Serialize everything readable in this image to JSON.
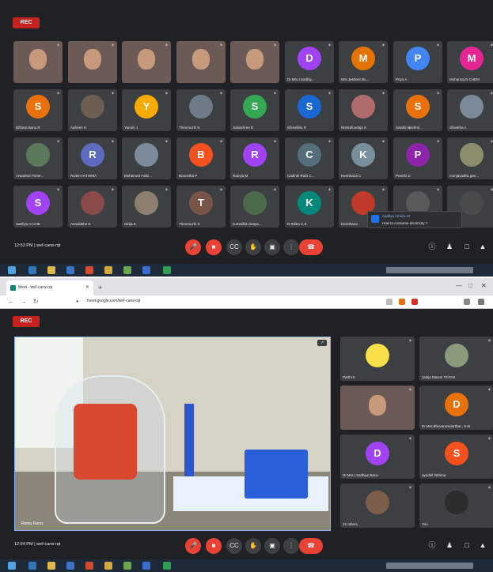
{
  "recording_label": "REC",
  "shot1": {
    "bottom_bar": {
      "time": "12:53 PM",
      "meeting_code": "wef-carw-rqt"
    },
    "participants": [
      {
        "name": "",
        "kind": "video"
      },
      {
        "name": "",
        "kind": "video"
      },
      {
        "name": "",
        "kind": "video"
      },
      {
        "name": "",
        "kind": "video"
      },
      {
        "name": "",
        "kind": "video"
      },
      {
        "name": "Dr.Mrs.I.Sadhiy...",
        "initial": "D",
        "color": "#a142f4"
      },
      {
        "name": "Mrs.Jeebeet Bo...",
        "initial": "M",
        "color": "#e37400"
      },
      {
        "name": "Priya A",
        "initial": "P",
        "color": "#4285f4"
      },
      {
        "name": "Mohanraj D CHEM",
        "initial": "M",
        "color": "#e52592"
      },
      {
        "name": "Dithara Banu.R",
        "initial": "S",
        "color": "#e8710a"
      },
      {
        "name": "Aafreen H",
        "initial": "",
        "color": "#6d5e52"
      },
      {
        "name": "Yamini J",
        "initial": "Y",
        "color": "#f9ab00"
      },
      {
        "name": "Thenmozhi K",
        "initial": "",
        "color": "#6f7b86"
      },
      {
        "name": "Subashree D",
        "initial": "S",
        "color": "#34a853"
      },
      {
        "name": "Shreebhu R",
        "initial": "S",
        "color": "#1967d2"
      },
      {
        "name": "Nishrafundaja S",
        "initial": "",
        "color": "#b06c6c"
      },
      {
        "name": "Swathi lakshmi...",
        "initial": "S",
        "color": "#e8710a"
      },
      {
        "name": "Shwetha A",
        "initial": "",
        "color": "#7a8a99"
      },
      {
        "name": "Anwathul Ferne...",
        "initial": "",
        "color": "#5b7a5b"
      },
      {
        "name": "RUBH FATHIMA",
        "initial": "R",
        "color": "#5c6bc0"
      },
      {
        "name": "Mohamed Fathi...",
        "initial": "",
        "color": "#7b8b9b"
      },
      {
        "name": "Bouvetha P",
        "initial": "B",
        "color": "#f4511e"
      },
      {
        "name": "Ramya M",
        "initial": "R",
        "color": "#a142f4"
      },
      {
        "name": "Cadinle Ruth C...",
        "initial": "C",
        "color": "#546e7a"
      },
      {
        "name": "Keerthana C",
        "initial": "K",
        "color": "#78909c"
      },
      {
        "name": "Preethi D",
        "initial": "P",
        "color": "#8e24aa"
      },
      {
        "name": "munjavadhu.gan...",
        "initial": "",
        "color": "#8d8d6d"
      },
      {
        "name": "Sathiya m CHE",
        "initial": "S",
        "color": "#a142f4"
      },
      {
        "name": "Annalakhe E",
        "initial": "",
        "color": "#8a4a4a"
      },
      {
        "name": "Girija E",
        "initial": "",
        "color": "#8d7f70"
      },
      {
        "name": "Thenmozhi S",
        "initial": "T",
        "color": "#795548"
      },
      {
        "name": "sumedha vinaya...",
        "initial": "",
        "color": "#4c6a4c"
      },
      {
        "name": "N Ritika C.S",
        "initial": "K",
        "color": "#00897b"
      },
      {
        "name": "Keerthana",
        "initial": "",
        "color": "#c0392b"
      },
      {
        "name": "",
        "initial": "",
        "color": "#5a5a5a"
      },
      {
        "name": "",
        "initial": "",
        "color": "#4a4a4a"
      }
    ],
    "chat_toast": {
      "sender": "Aaditya Amula..M",
      "message": "How to consume electricity ?"
    }
  },
  "shot2": {
    "browser": {
      "tab_title": "Meet - wef-carw-rqt",
      "url": "meet.google.com/wef-carw-rqt"
    },
    "presenter_name": "Ramu Rams",
    "side_tiles": [
      {
        "name": "Parthi K",
        "initial": "",
        "color": "#f9e04b",
        "kind": "emoji"
      },
      {
        "name": "Jalaja Mason TCPAS",
        "initial": "",
        "color": "#8a9a7a"
      },
      {
        "name": "",
        "initial": "",
        "color": "",
        "kind": "video"
      },
      {
        "name": "Dr.Mrs.Bhuvaneswarthar...S.M",
        "initial": "D",
        "color": "#e8710a"
      },
      {
        "name": "Dr.Mrs.I.Sadhiya Banu",
        "initial": "D",
        "color": "#a142f4"
      },
      {
        "name": "ayodall fathima",
        "initial": "S",
        "color": "#f4511e"
      },
      {
        "name": "15 others",
        "initial": "",
        "color": "#7b5e4a",
        "kind": "group"
      },
      {
        "name": "You",
        "initial": "",
        "color": "#2c2c2c"
      }
    ],
    "bottom_bar": {
      "time": "12:54 PM",
      "meeting_code": "wef-carw-rqt"
    }
  },
  "controls": {
    "mic": "mic-off-icon",
    "camera": "camera-off-icon",
    "captions": "captions-icon",
    "raise_hand": "raise-hand-icon",
    "present": "present-icon",
    "more": "more-options-icon",
    "end_call": "end-call-icon",
    "info": "info-icon",
    "people": "people-icon",
    "chat": "chat-icon",
    "activities": "activities-icon"
  },
  "colors": {
    "meet_bg": "#202124",
    "tile_bg": "#3c4043",
    "danger": "#ea4335",
    "accent": "#8ab4f8",
    "taskbar": "#1f2a38"
  }
}
